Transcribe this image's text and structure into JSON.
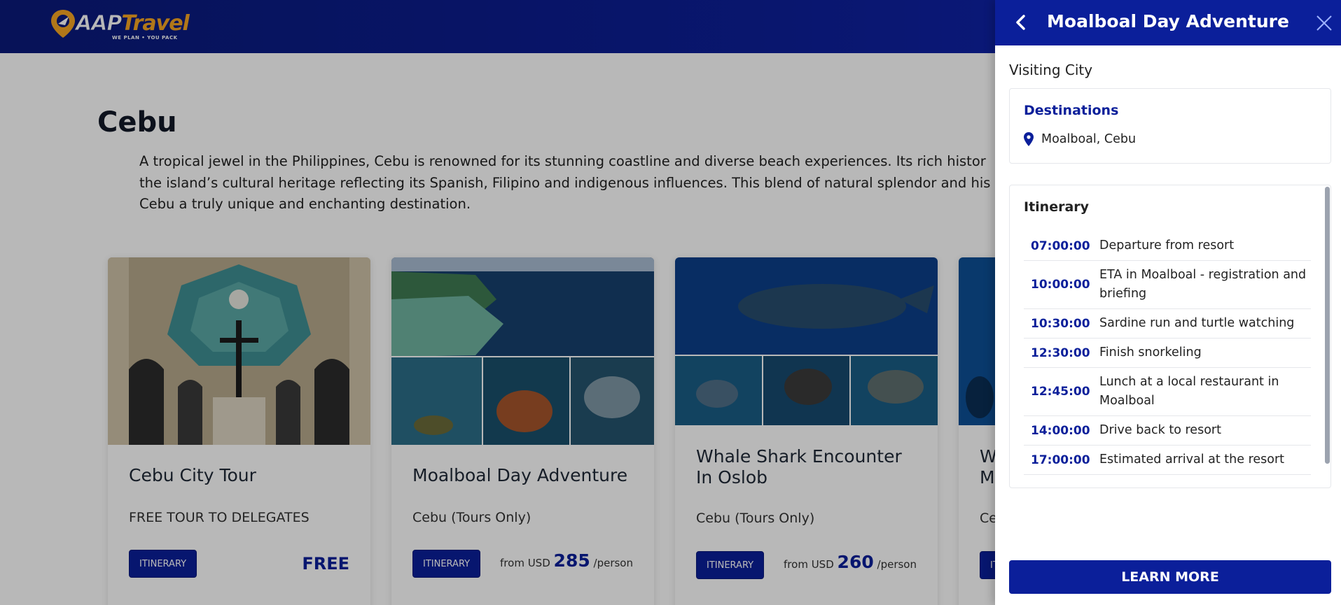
{
  "header": {
    "logo_text_a": "AAP",
    "logo_text_b": "Travel",
    "logo_tagline": "WE PLAN • YOU PACK"
  },
  "city": {
    "title": "Cebu",
    "description_lines": [
      "A tropical jewel in the Philippines, Cebu is renowned for its stunning coastline and diverse beach experiences. Its rich histor",
      "the island’s cultural heritage reflecting its Spanish, Filipino and indigenous influences. This blend of natural splendor and his",
      "Cebu a truly unique and enchanting destination."
    ]
  },
  "tours": [
    {
      "title": "Cebu City Tour",
      "subtitle": "FREE TOUR TO DELEGATES",
      "button": "ITINERARY",
      "price": "FREE"
    },
    {
      "title": "Moalboal Day Adventure",
      "subtitle": "Cebu (Tours Only)",
      "button": "ITINERARY",
      "price_prefix": "from USD",
      "price_amount": "285",
      "price_suffix": "/person"
    },
    {
      "title_line1": "Whale Shark Encounter",
      "title_line2": "In Oslob",
      "subtitle": "Cebu (Tours Only)",
      "button": "ITINERARY",
      "price_prefix": "from USD",
      "price_amount": "260",
      "price_suffix": "/person"
    },
    {
      "title_line1": "W",
      "title_line2": "M",
      "subtitle": "Ce",
      "button": "IT"
    }
  ],
  "panel": {
    "title": "Moalboal Day Adventure",
    "visiting_label": "Visiting City",
    "destinations_label": "Destinations",
    "destination": "Moalboal, Cebu",
    "itinerary_label": "Itinerary",
    "itinerary": [
      {
        "time": "07:00:00",
        "text": "Departure from resort"
      },
      {
        "time": "10:00:00",
        "text": "ETA in Moalboal - registration and briefing"
      },
      {
        "time": "10:30:00",
        "text": "Sardine run and turtle watching"
      },
      {
        "time": "12:30:00",
        "text": "Finish snorkeling"
      },
      {
        "time": "12:45:00",
        "text": "Lunch at a local restaurant in Moalboal"
      },
      {
        "time": "14:00:00",
        "text": "Drive back to resort"
      },
      {
        "time": "17:00:00",
        "text": "Estimated arrival at the resort"
      }
    ],
    "learn_more": "LEARN MORE"
  },
  "colors": {
    "brand_blue": "#0b1f9a",
    "accent_orange": "#f5a623",
    "card_footer": "#5bb0c8"
  }
}
